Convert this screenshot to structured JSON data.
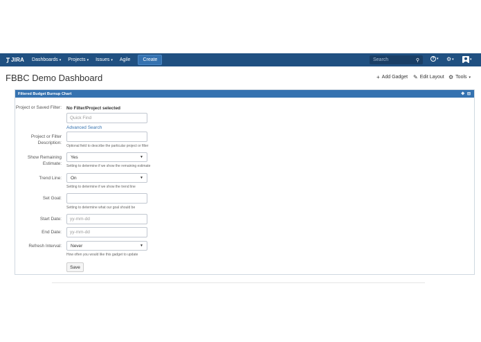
{
  "nav": {
    "logo_text": "JIRA",
    "items": [
      {
        "label": "Dashboards",
        "caret": "▾"
      },
      {
        "label": "Projects",
        "caret": "▾"
      },
      {
        "label": "Issues",
        "caret": "▾"
      },
      {
        "label": "Agile",
        "caret": ""
      }
    ],
    "create_label": "Create",
    "search_placeholder": "Search",
    "search_icon": "⚲",
    "help_icon": "?",
    "gear_icon": "⚙",
    "caret": "▾",
    "colors": {
      "bar": "#205081",
      "create": "#3572b0"
    }
  },
  "dashboard": {
    "title": "FBBC Demo Dashboard",
    "add_gadget": "Add Gadget",
    "edit_layout": "Edit Layout",
    "tools": "Tools"
  },
  "gadget": {
    "title": "Filtered Budget Burnup Chart",
    "header_icons": "✥ ⊟",
    "filter_label": "Project or Saved Filter:",
    "filter_value": "No Filter/Project selected",
    "quick_find_placeholder": "Quick Find",
    "advanced_search": "Advanced Search",
    "description_label": "Project or Filter Description:",
    "description_help": "Optional field to describe the particular project or filter",
    "remaining_label": "Show Remaining Estimate:",
    "remaining_value": "Yes",
    "remaining_help": "Setting to determine if we show the remaining estimate",
    "trend_label": "Trend Line:",
    "trend_value": "On",
    "trend_help": "Setting to determine if we show the trend line",
    "goal_label": "Set Goal:",
    "goal_help": "Setting to determine what our goal should be",
    "start_label": "Start Date:",
    "start_placeholder": "yy-mm-dd",
    "end_label": "End Date:",
    "end_placeholder": "yy-mm-dd",
    "refresh_label": "Refresh Interval:",
    "refresh_value": "Never",
    "refresh_help": "How often you would like this gadget to update",
    "save_label": "Save",
    "select_arrow": "▼"
  }
}
